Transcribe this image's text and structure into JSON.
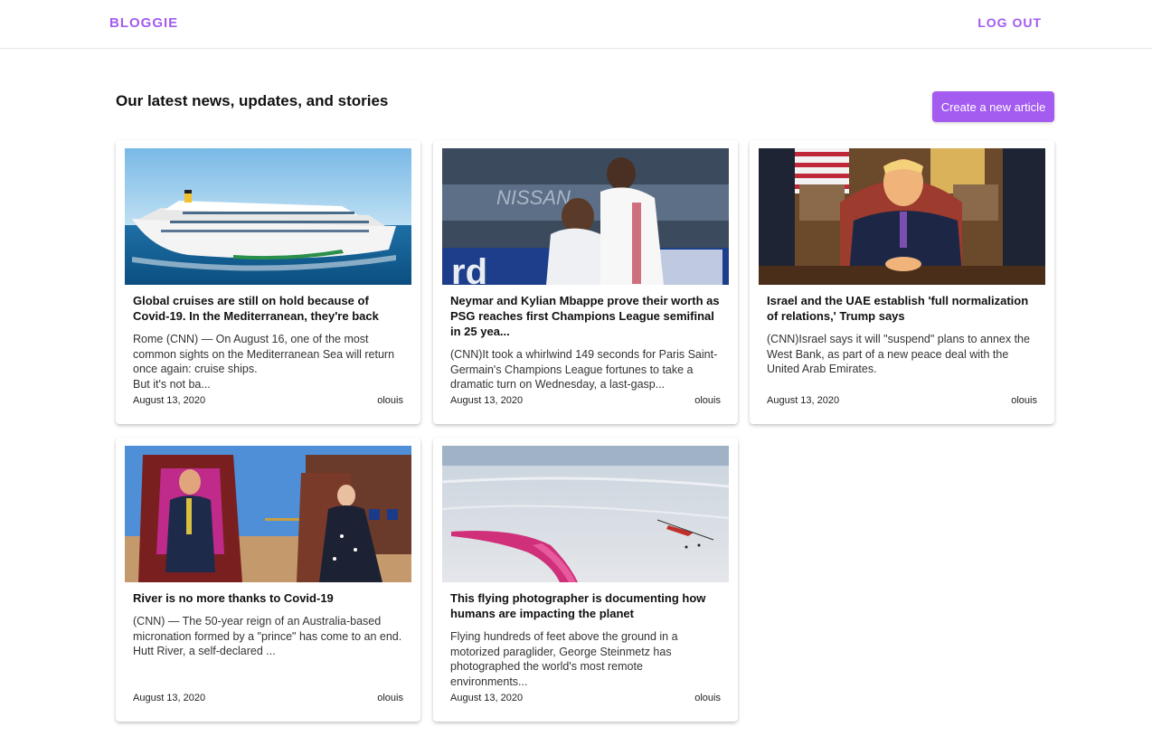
{
  "header": {
    "brand": "BLOGGIE",
    "logout_label": "LOG OUT"
  },
  "colors": {
    "accent": "#a35bf0"
  },
  "main": {
    "title": "Our latest news, updates, and stories",
    "create_label": "Create a new article"
  },
  "articles": [
    {
      "title": "Global cruises are still on hold because of Covid-19. In the Mediterranean, they're back",
      "excerpt": "Rome (CNN) — On August 16, one of the most common sights on the Mediterranean Sea will return once again: cruise ships.\nBut it's not ba...",
      "date": "August 13, 2020",
      "author": "olouis",
      "image": "cruise-ship-photo"
    },
    {
      "title": "Neymar and Kylian Mbappe prove their worth as PSG reaches first Champions League semifinal in 25 yea...",
      "excerpt": "(CNN)It took a whirlwind 149 seconds for Paris Saint-Germain's Champions League fortunes to take a dramatic turn on Wednesday, a last-gasp...",
      "date": "August 13, 2020",
      "author": "olouis",
      "image": "football-players-photo"
    },
    {
      "title": "Israel and the UAE establish 'full normalization of relations,' Trump says",
      "excerpt": "(CNN)Israel says it will \"suspend\" plans to annex the West Bank, as part of a new peace deal with the United Arab Emirates.",
      "date": "August 13, 2020",
      "author": "olouis",
      "image": "oval-office-photo"
    },
    {
      "title": "River is no more thanks to Covid-19",
      "excerpt": "(CNN) — The 50-year reign of an Australia-based micronation formed by a \"prince\" has come to an end.\nHutt River, a self-declared ...",
      "date": "August 13, 2020",
      "author": "olouis",
      "image": "thrones-photo"
    },
    {
      "title": "This flying photographer is documenting how humans are impacting the planet",
      "excerpt": "Flying hundreds of feet above the ground in a motorized paraglider, George Steinmetz has photographed the world's most remote environments...",
      "date": "August 13, 2020",
      "author": "olouis",
      "image": "ice-field-photo"
    }
  ]
}
